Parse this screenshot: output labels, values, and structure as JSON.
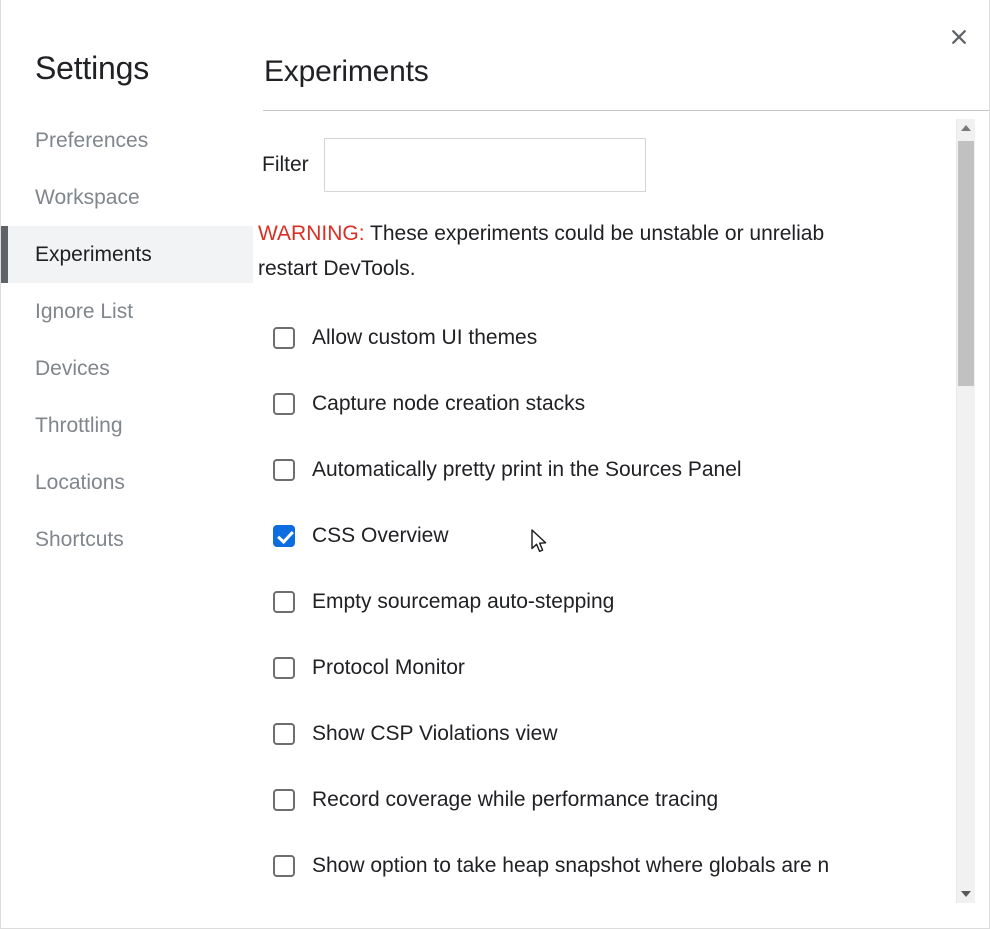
{
  "window": {
    "close_label": "✕"
  },
  "sidebar": {
    "title": "Settings",
    "items": [
      {
        "label": "Preferences",
        "selected": false
      },
      {
        "label": "Workspace",
        "selected": false
      },
      {
        "label": "Experiments",
        "selected": true
      },
      {
        "label": "Ignore List",
        "selected": false
      },
      {
        "label": "Devices",
        "selected": false
      },
      {
        "label": "Throttling",
        "selected": false
      },
      {
        "label": "Locations",
        "selected": false
      },
      {
        "label": "Shortcuts",
        "selected": false
      }
    ]
  },
  "main": {
    "panel_title": "Experiments",
    "filter": {
      "label": "Filter",
      "value": "",
      "placeholder": ""
    },
    "warning": {
      "prefix": "WARNING:",
      "line1": " These experiments could be unstable or unreliab",
      "line2": "restart DevTools."
    },
    "experiments": [
      {
        "label": "Allow custom UI themes",
        "checked": false
      },
      {
        "label": "Capture node creation stacks",
        "checked": false
      },
      {
        "label": "Automatically pretty print in the Sources Panel",
        "checked": false
      },
      {
        "label": "CSS Overview",
        "checked": true
      },
      {
        "label": "Empty sourcemap auto-stepping",
        "checked": false
      },
      {
        "label": "Protocol Monitor",
        "checked": false
      },
      {
        "label": "Show CSP Violations view",
        "checked": false
      },
      {
        "label": "Record coverage while performance tracing",
        "checked": false
      },
      {
        "label": "Show option to take heap snapshot where globals are n",
        "checked": false
      }
    ]
  },
  "scrollbar": {
    "up_arrow": "scroll-up",
    "down_arrow": "scroll-down"
  },
  "colors": {
    "accent_blue": "#0d6ce0",
    "warning_red": "#d93025",
    "selected_bg": "#f1f3f4",
    "selected_bar": "#5f6368",
    "text": "#202124",
    "muted_text": "#80868b"
  }
}
